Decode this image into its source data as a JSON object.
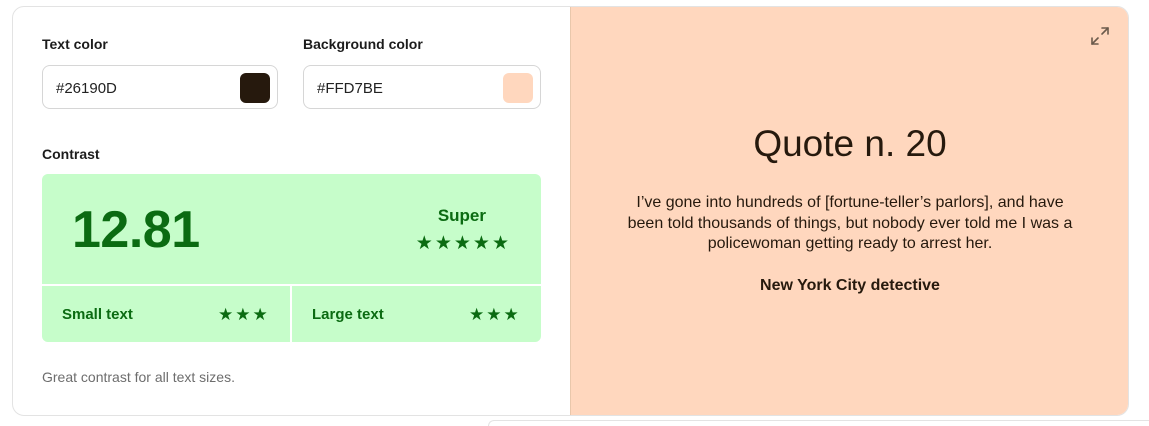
{
  "text_color": {
    "label": "Text color",
    "value": "#26190D"
  },
  "background_color": {
    "label": "Background color",
    "value": "#FFD7BE"
  },
  "contrast": {
    "label": "Contrast",
    "ratio": "12.81",
    "rating": "Super",
    "rating_stars": 5,
    "small_text_label": "Small text",
    "small_text_stars": 3,
    "large_text_label": "Large text",
    "large_text_stars": 3,
    "note": "Great contrast for all text sizes.",
    "accent_color": "#0b6b12",
    "box_color": "#c6fdca"
  },
  "preview": {
    "title": "Quote n. 20",
    "body": "I’ve gone into hundreds of [fortune-teller’s parlors], and have been told thousands of things, but nobody ever told me I was a policewoman getting ready to arrest her.",
    "author": "New York City detective",
    "expand_icon": "expand-icon"
  }
}
